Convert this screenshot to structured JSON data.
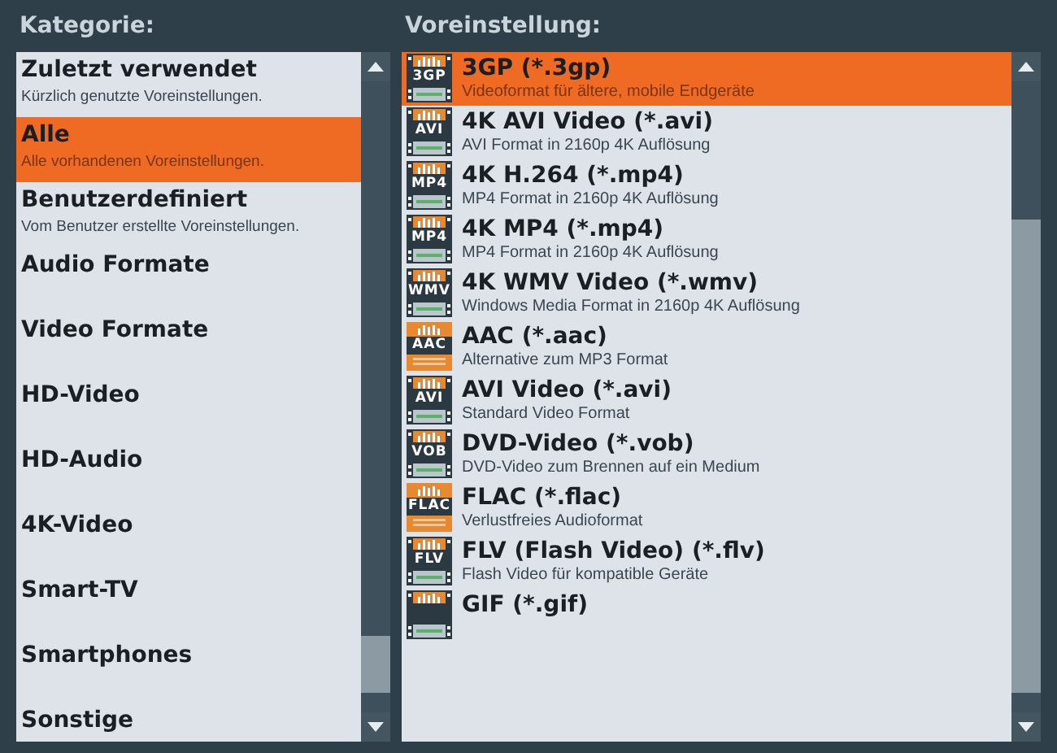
{
  "category_panel": {
    "heading": "Kategorie:",
    "items": [
      {
        "title": "Zuletzt verwendet",
        "description": "Kürzlich genutzte Voreinstellungen.",
        "selected": false
      },
      {
        "title": "Alle",
        "description": "Alle vorhandenen Voreinstellungen.",
        "selected": true
      },
      {
        "title": "Benutzerdefiniert",
        "description": "Vom Benutzer erstellte Voreinstellungen.",
        "selected": false
      },
      {
        "title": "Audio Formate",
        "selected": false
      },
      {
        "title": "Video Formate",
        "selected": false
      },
      {
        "title": "HD-Video",
        "selected": false
      },
      {
        "title": "HD-Audio",
        "selected": false
      },
      {
        "title": "4K-Video",
        "selected": false
      },
      {
        "title": "Smart-TV",
        "selected": false
      },
      {
        "title": "Smartphones",
        "selected": false
      },
      {
        "title": "Sonstige",
        "selected": false
      }
    ]
  },
  "preset_panel": {
    "heading": "Voreinstellung:",
    "items": [
      {
        "kind": "video",
        "icon_label": "3GP",
        "title": "3GP (*.3gp)",
        "description": "Videoformat für ältere, mobile Endgeräte",
        "selected": true
      },
      {
        "kind": "video",
        "icon_label": "AVI",
        "title": "4K AVI Video (*.avi)",
        "description": "AVI Format in 2160p 4K Auflösung",
        "selected": false
      },
      {
        "kind": "video",
        "icon_label": "MP4",
        "title": "4K H.264 (*.mp4)",
        "description": "MP4 Format in 2160p 4K Auflösung",
        "selected": false
      },
      {
        "kind": "video",
        "icon_label": "MP4",
        "title": "4K MP4 (*.mp4)",
        "description": "MP4 Format in 2160p 4K Auflösung",
        "selected": false
      },
      {
        "kind": "video",
        "icon_label": "WMV",
        "title": "4K WMV Video (*.wmv)",
        "description": "Windows Media Format in 2160p 4K Auflösung",
        "selected": false
      },
      {
        "kind": "audio",
        "icon_label": "AAC",
        "title": "AAC (*.aac)",
        "description": "Alternative zum MP3 Format",
        "selected": false
      },
      {
        "kind": "video",
        "icon_label": "AVI",
        "title": "AVI Video (*.avi)",
        "description": "Standard Video Format",
        "selected": false
      },
      {
        "kind": "video",
        "icon_label": "VOB",
        "title": "DVD-Video (*.vob)",
        "description": "DVD-Video zum Brennen auf ein Medium",
        "selected": false
      },
      {
        "kind": "audio",
        "icon_label": "FLAC",
        "title": "FLAC (*.flac)",
        "description": "Verlustfreies Audioformat",
        "selected": false
      },
      {
        "kind": "video",
        "icon_label": "FLV",
        "title": "FLV (Flash Video) (*.flv)",
        "description": "Flash Video für kompatible Geräte",
        "selected": false
      },
      {
        "kind": "video",
        "title": "GIF (*.gif)",
        "selected": false
      }
    ]
  }
}
